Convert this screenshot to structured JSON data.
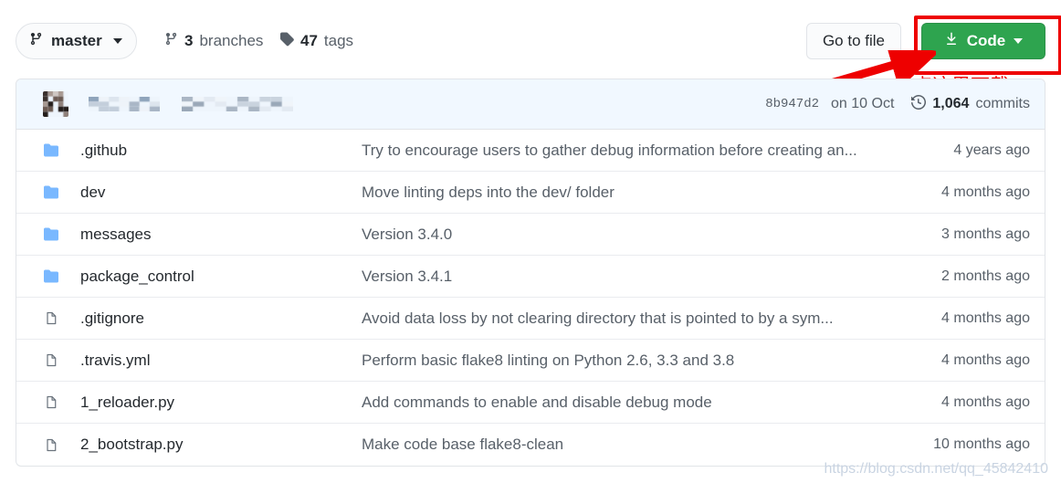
{
  "toolbar": {
    "branch_label": "master",
    "branch_icon": "git-branch-icon",
    "branches_count": "3",
    "branches_label": "branches",
    "tags_count": "47",
    "tags_label": "tags",
    "goto_file_label": "Go to file",
    "code_label": "Code",
    "code_icon": "download-icon",
    "code_button_color": "#2ea44f"
  },
  "annotation": {
    "text": "点这里下载",
    "color": "#ee0000"
  },
  "commit_bar": {
    "author": "",
    "message": "",
    "sha": "8b947d2",
    "date": "on 10 Oct",
    "commits_count": "1,064",
    "commits_label": "commits",
    "clock_icon": "history-clock-icon",
    "background": "#f1f8ff"
  },
  "files": [
    {
      "icon": "folder-icon",
      "type": "folder",
      "name": ".github",
      "message": "Try to encourage users to gather debug information before creating an...",
      "age": "4 years ago"
    },
    {
      "icon": "folder-icon",
      "type": "folder",
      "name": "dev",
      "message": "Move linting deps into the dev/ folder",
      "age": "4 months ago"
    },
    {
      "icon": "folder-icon",
      "type": "folder",
      "name": "messages",
      "message": "Version 3.4.0",
      "age": "3 months ago"
    },
    {
      "icon": "folder-icon",
      "type": "folder",
      "name": "package_control",
      "message": "Version 3.4.1",
      "age": "2 months ago"
    },
    {
      "icon": "file-icon",
      "type": "file",
      "name": ".gitignore",
      "message": "Avoid data loss by not clearing directory that is pointed to by a sym...",
      "age": "4 months ago"
    },
    {
      "icon": "file-icon",
      "type": "file",
      "name": ".travis.yml",
      "message": "Perform basic flake8 linting on Python 2.6, 3.3 and 3.8",
      "age": "4 months ago"
    },
    {
      "icon": "file-icon",
      "type": "file",
      "name": "1_reloader.py",
      "message": "Add commands to enable and disable debug mode",
      "age": "4 months ago"
    },
    {
      "icon": "file-icon",
      "type": "file",
      "name": "2_bootstrap.py",
      "message": "Make code base flake8-clean",
      "age": "10 months ago"
    }
  ],
  "watermark": "https://blog.csdn.net/qq_45842410"
}
